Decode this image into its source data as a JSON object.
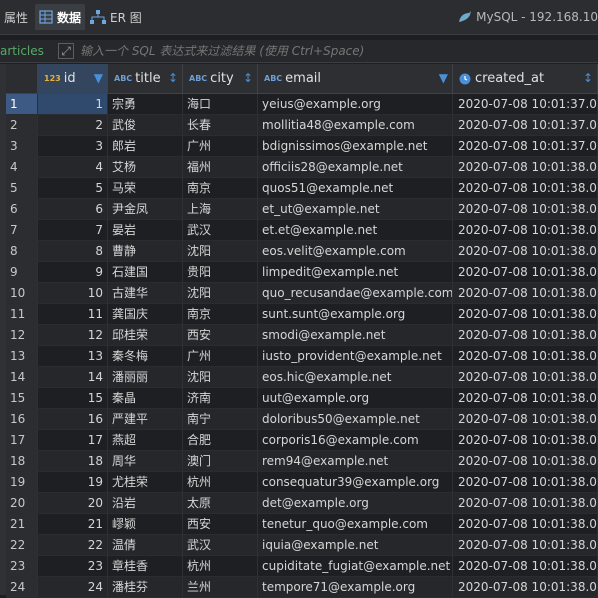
{
  "toolbar": {
    "tabs": [
      {
        "label": "属性"
      },
      {
        "label": "数据"
      },
      {
        "label": "ER 图"
      }
    ],
    "connection": "MySQL - 192.168.10"
  },
  "filter": {
    "table_name": "articles",
    "placeholder": "输入一个 SQL 表达式来过滤结果 (使用 Ctrl+Space)"
  },
  "columns": [
    {
      "type": "123",
      "name": "id"
    },
    {
      "type": "ABC",
      "name": "title"
    },
    {
      "type": "ABC",
      "name": "city"
    },
    {
      "type": "ABC",
      "name": "email"
    },
    {
      "type": "clock",
      "name": "created_at"
    }
  ],
  "rows": [
    {
      "n": "1",
      "id": "1",
      "title": "宗勇",
      "city": "海口",
      "email": "yeius@example.org",
      "created_at": "2020-07-08 10:01:37.0"
    },
    {
      "n": "2",
      "id": "2",
      "title": "武俊",
      "city": "长春",
      "email": "mollitia48@example.com",
      "created_at": "2020-07-08 10:01:37.0"
    },
    {
      "n": "3",
      "id": "3",
      "title": "郎岩",
      "city": "广州",
      "email": "bdignissimos@example.net",
      "created_at": "2020-07-08 10:01:37.0"
    },
    {
      "n": "4",
      "id": "4",
      "title": "艾杨",
      "city": "福州",
      "email": "officiis28@example.net",
      "created_at": "2020-07-08 10:01:38.0"
    },
    {
      "n": "5",
      "id": "5",
      "title": "马荣",
      "city": "南京",
      "email": "quos51@example.net",
      "created_at": "2020-07-08 10:01:38.0"
    },
    {
      "n": "6",
      "id": "6",
      "title": "尹金凤",
      "city": "上海",
      "email": "et_ut@example.net",
      "created_at": "2020-07-08 10:01:38.0"
    },
    {
      "n": "7",
      "id": "7",
      "title": "晏岩",
      "city": "武汉",
      "email": "et.et@example.net",
      "created_at": "2020-07-08 10:01:38.0"
    },
    {
      "n": "8",
      "id": "8",
      "title": "曹静",
      "city": "沈阳",
      "email": "eos.velit@example.com",
      "created_at": "2020-07-08 10:01:38.0"
    },
    {
      "n": "9",
      "id": "9",
      "title": "石建国",
      "city": "贵阳",
      "email": "limpedit@example.net",
      "created_at": "2020-07-08 10:01:38.0"
    },
    {
      "n": "10",
      "id": "10",
      "title": "古建华",
      "city": "沈阳",
      "email": "quo_recusandae@example.com",
      "created_at": "2020-07-08 10:01:38.0"
    },
    {
      "n": "11",
      "id": "11",
      "title": "龚国庆",
      "city": "南京",
      "email": "sunt.sunt@example.org",
      "created_at": "2020-07-08 10:01:38.0"
    },
    {
      "n": "12",
      "id": "12",
      "title": "邱桂荣",
      "city": "西安",
      "email": "smodi@example.net",
      "created_at": "2020-07-08 10:01:38.0"
    },
    {
      "n": "13",
      "id": "13",
      "title": "秦冬梅",
      "city": "广州",
      "email": "iusto_provident@example.net",
      "created_at": "2020-07-08 10:01:38.0"
    },
    {
      "n": "14",
      "id": "14",
      "title": "潘丽丽",
      "city": "沈阳",
      "email": "eos.hic@example.net",
      "created_at": "2020-07-08 10:01:38.0"
    },
    {
      "n": "15",
      "id": "15",
      "title": "秦晶",
      "city": "济南",
      "email": "uut@example.org",
      "created_at": "2020-07-08 10:01:38.0"
    },
    {
      "n": "16",
      "id": "16",
      "title": "严建平",
      "city": "南宁",
      "email": "doloribus50@example.net",
      "created_at": "2020-07-08 10:01:38.0"
    },
    {
      "n": "17",
      "id": "17",
      "title": "燕超",
      "city": "合肥",
      "email": "corporis16@example.com",
      "created_at": "2020-07-08 10:01:38.0"
    },
    {
      "n": "18",
      "id": "18",
      "title": "周华",
      "city": "澳门",
      "email": "rem94@example.net",
      "created_at": "2020-07-08 10:01:38.0"
    },
    {
      "n": "19",
      "id": "19",
      "title": "尤桂荣",
      "city": "杭州",
      "email": "consequatur39@example.org",
      "created_at": "2020-07-08 10:01:38.0"
    },
    {
      "n": "20",
      "id": "20",
      "title": "沿岩",
      "city": "太原",
      "email": "det@example.org",
      "created_at": "2020-07-08 10:01:38.0"
    },
    {
      "n": "21",
      "id": "21",
      "title": "嵺颖",
      "city": "西安",
      "email": "tenetur_quo@example.com",
      "created_at": "2020-07-08 10:01:38.0"
    },
    {
      "n": "22",
      "id": "22",
      "title": "温倩",
      "city": "武汉",
      "email": "iquia@example.net",
      "created_at": "2020-07-08 10:01:38.0"
    },
    {
      "n": "23",
      "id": "23",
      "title": "章桂香",
      "city": "杭州",
      "email": "cupiditate_fugiat@example.net",
      "created_at": "2020-07-08 10:01:38.0"
    },
    {
      "n": "24",
      "id": "24",
      "title": "潘桂芬",
      "city": "兰州",
      "email": "tempore71@example.org",
      "created_at": "2020-07-08 10:01:38.0"
    }
  ]
}
